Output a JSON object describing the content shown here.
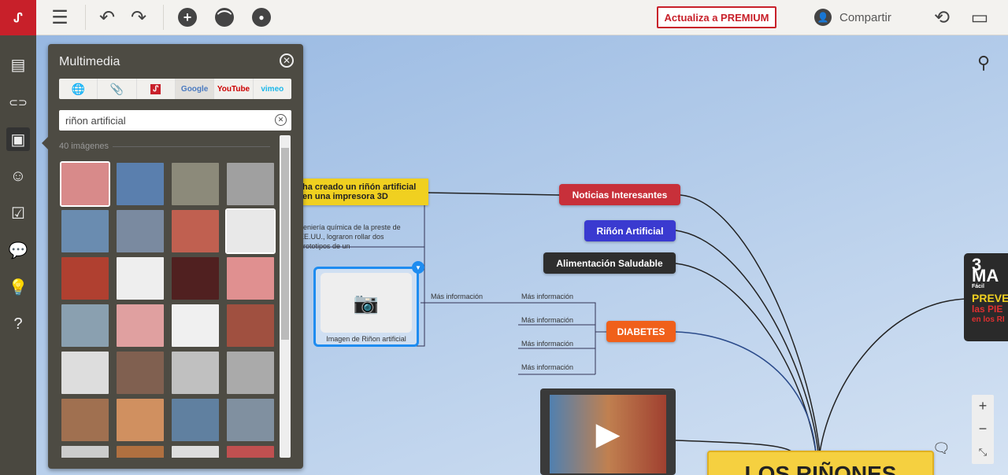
{
  "toolbar": {
    "logo": "mindomo-logo",
    "premium": "Actualiza a PREMIUM",
    "share": "Compartir"
  },
  "panel": {
    "title": "Multimedia",
    "tabs": [
      "web",
      "attach",
      "mindomo",
      "Google",
      "YouTube",
      "vimeo"
    ],
    "search_value": "riñon artificial",
    "count": "40 imágenes",
    "thumb_colors": [
      "#d88a8a",
      "#5a7fae",
      "#8c8a7a",
      "#a0a0a0",
      "#6a8cb0",
      "#7a8aa0",
      "#c06050",
      "#e8e8e8",
      "#b04030",
      "#eeeeee",
      "#502020",
      "#e09090",
      "#8aa0b0",
      "#e0a0a0",
      "#f0f0f0",
      "#a05040",
      "#dddddd",
      "#806050",
      "#c0c0c0",
      "#aaaaaa",
      "#a07050",
      "#d09060",
      "#6080a0",
      "#8090a0",
      "#ccc",
      "#b07040",
      "#ddd",
      "#c05050"
    ]
  },
  "map": {
    "yellow_node": "ha creado un riñón artificial en una impresora 3D",
    "note": "geniería química de la preste de EE.UU., lograron rollar dos prototipos de un",
    "image_caption": "Imagen de Riñon artificial",
    "link_left": "Más información",
    "links": [
      "Más información",
      "Más información",
      "Más información",
      "Más información"
    ],
    "nodes": {
      "noticias": "Noticias Interesantes",
      "rinon": "Riñón Artificial",
      "alimentacion": "Alimentación Saludable",
      "diabetes": "DIABETES"
    },
    "central": "LOS RIÑONES",
    "poster": [
      "3 MA",
      "Fácil",
      "PREVE",
      "las PIE",
      "en los RI"
    ],
    "colors": {
      "noticias": "#c8303a",
      "rinon": "#3a3ad0",
      "alimentacion": "#2e2e2e",
      "diabetes": "#f0601a",
      "central": "#f5d040"
    }
  }
}
